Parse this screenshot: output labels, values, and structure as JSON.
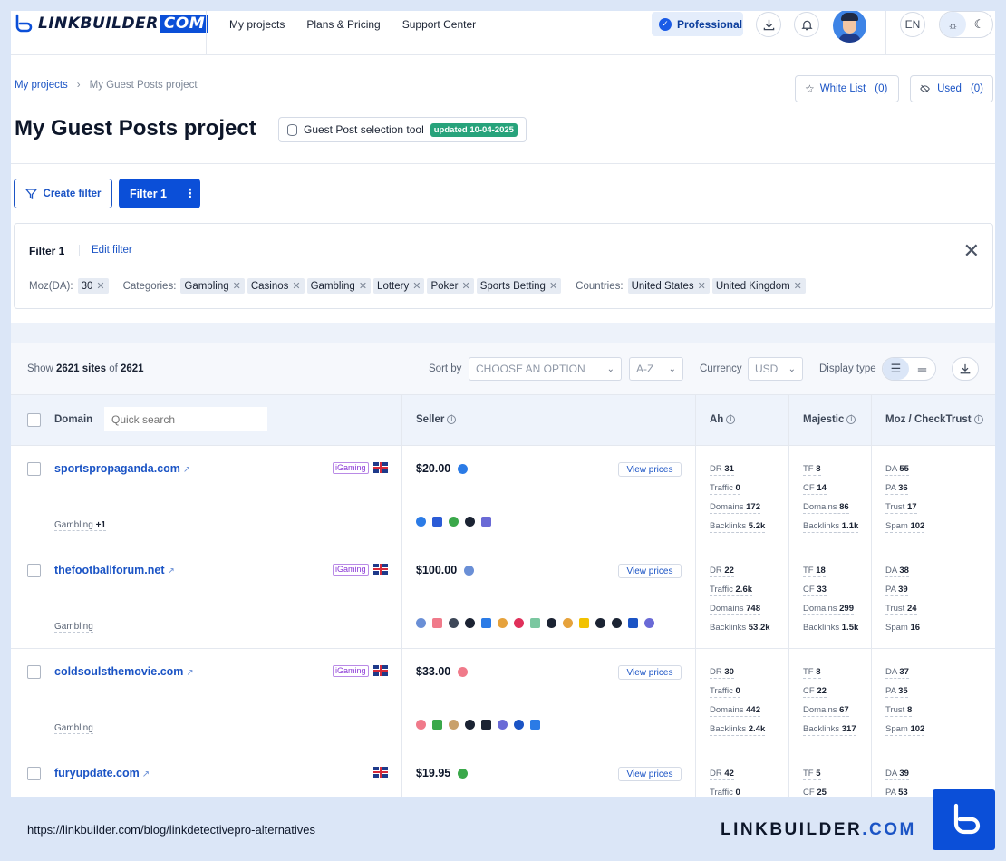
{
  "header": {
    "logo_text": "LINKBUILDER",
    "logo_com": "COM",
    "nav": [
      "My projects",
      "Plans & Pricing",
      "Support Center"
    ],
    "plan_badge": "Professional",
    "lang": "EN"
  },
  "breadcrumb": {
    "root": "My projects",
    "current": "My Guest Posts project"
  },
  "white_list": {
    "label": "White List",
    "count": "(0)"
  },
  "used": {
    "label": "Used",
    "count": "(0)"
  },
  "page_title": "My Guest Posts project",
  "tool": {
    "label": "Guest Post selection tool",
    "updated": "updated 10-04-2025"
  },
  "filters": {
    "create_label": "Create filter",
    "active_label": "Filter 1",
    "panel_title": "Filter 1",
    "edit_label": "Edit filter",
    "moz_label": "Moz(DA):",
    "moz_values": [
      "30"
    ],
    "categories_label": "Categories:",
    "categories": [
      "Gambling",
      "Casinos",
      "Gambling",
      "Lottery",
      "Poker",
      "Sports Betting"
    ],
    "countries_label": "Countries:",
    "countries": [
      "United States",
      "United Kingdom"
    ]
  },
  "toolbar": {
    "show_prefix": "Show",
    "shown": "2621 sites",
    "of": "of",
    "total": "2621",
    "sort_label": "Sort by",
    "sort_placeholder": "CHOOSE AN OPTION",
    "order": "A-Z",
    "currency_label": "Currency",
    "currency": "USD",
    "display_label": "Display type"
  },
  "columns": {
    "domain": "Domain",
    "search_placeholder": "Quick search",
    "seller": "Seller",
    "ah": "Ah",
    "majestic": "Majestic",
    "moz": "Moz / CheckTrust"
  },
  "view_prices_label": "View prices",
  "rows": [
    {
      "domain": "sportspropaganda.com",
      "igaming": "iGaming",
      "category": "Gambling",
      "extra": "+1",
      "price": "$20.00",
      "ah": {
        "dr": "31",
        "traffic": "0",
        "domains": "172",
        "backlinks": "5.2k"
      },
      "maj": {
        "tf": "8",
        "cf": "14",
        "domains": "86",
        "backlinks": "1.1k"
      },
      "moz": {
        "da": "55",
        "pa": "36",
        "trust": "17",
        "spam": "102"
      }
    },
    {
      "domain": "thefootballforum.net",
      "igaming": "iGaming",
      "category": "Gambling",
      "extra": "",
      "price": "$100.00",
      "ah": {
        "dr": "22",
        "traffic": "2.6k",
        "domains": "748",
        "backlinks": "53.2k"
      },
      "maj": {
        "tf": "18",
        "cf": "33",
        "domains": "299",
        "backlinks": "1.5k"
      },
      "moz": {
        "da": "38",
        "pa": "39",
        "trust": "24",
        "spam": "16"
      }
    },
    {
      "domain": "coldsoulsthemovie.com",
      "igaming": "iGaming",
      "category": "Gambling",
      "extra": "",
      "price": "$33.00",
      "ah": {
        "dr": "30",
        "traffic": "0",
        "domains": "442",
        "backlinks": "2.4k"
      },
      "maj": {
        "tf": "8",
        "cf": "22",
        "domains": "67",
        "backlinks": "317"
      },
      "moz": {
        "da": "37",
        "pa": "35",
        "trust": "8",
        "spam": "102"
      }
    },
    {
      "domain": "furyupdate.com",
      "igaming": "",
      "category": "",
      "extra": "",
      "price": "$19.95",
      "ah": {
        "dr": "42",
        "traffic": "0"
      },
      "maj": {
        "tf": "5",
        "cf": "25"
      },
      "moz": {
        "da": "39",
        "pa": "53"
      }
    }
  ],
  "metric_labels": {
    "dr": "DR",
    "traffic": "Traffic",
    "domains": "Domains",
    "backlinks": "Backlinks",
    "tf": "TF",
    "cf": "CF",
    "da": "DA",
    "pa": "PA",
    "trust": "Trust",
    "spam": "Spam"
  },
  "footer": {
    "url": "https://linkbuilder.com/blog/linkdetectivepro-alternatives",
    "brand": "LINKBUILDER",
    "brand_dot": ".COM"
  },
  "colors": {
    "accent": "#0b4fd8",
    "igaming": "#8a36d6",
    "updated": "#27a37b"
  }
}
